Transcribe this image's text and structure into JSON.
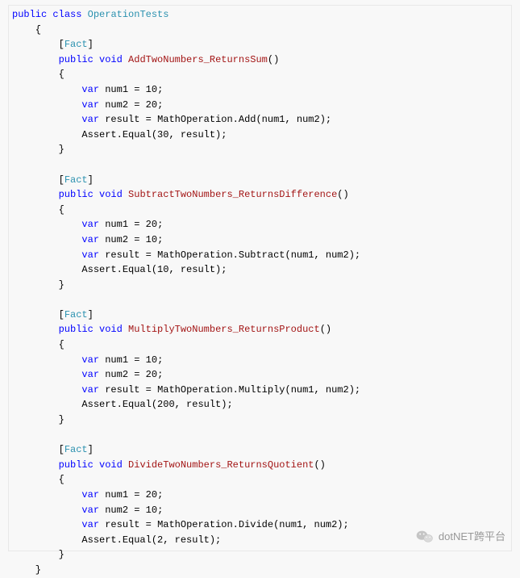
{
  "code": {
    "class_keywords": {
      "public": "public",
      "class": "class",
      "void": "void",
      "var": "var"
    },
    "class_name": "OperationTests",
    "attribute": "Fact",
    "methods": [
      {
        "name": "AddTwoNumbers_ReturnsSum",
        "body": {
          "line1_decl": "num1",
          "line1_val": "10",
          "line2_decl": "num2",
          "line2_val": "20",
          "line3_decl": "result",
          "line3_call": "MathOperation.Add(num1, num2);",
          "assert": "Assert.Equal(30, result);"
        }
      },
      {
        "name": "SubtractTwoNumbers_ReturnsDifference",
        "body": {
          "line1_decl": "num1",
          "line1_val": "20",
          "line2_decl": "num2",
          "line2_val": "10",
          "line3_decl": "result",
          "line3_call": "MathOperation.Subtract(num1, num2);",
          "assert": "Assert.Equal(10, result);"
        }
      },
      {
        "name": "MultiplyTwoNumbers_ReturnsProduct",
        "body": {
          "line1_decl": "num1",
          "line1_val": "10",
          "line2_decl": "num2",
          "line2_val": "20",
          "line3_decl": "result",
          "line3_call": "MathOperation.Multiply(num1, num2);",
          "assert": "Assert.Equal(200, result);"
        }
      },
      {
        "name": "DivideTwoNumbers_ReturnsQuotient",
        "body": {
          "line1_decl": "num1",
          "line1_val": "20",
          "line2_decl": "num2",
          "line2_val": "10",
          "line3_decl": "result",
          "line3_call": "MathOperation.Divide(num1, num2);",
          "assert": "Assert.Equal(2, result);"
        }
      }
    ]
  },
  "watermark": {
    "text": "dotNET跨平台"
  }
}
